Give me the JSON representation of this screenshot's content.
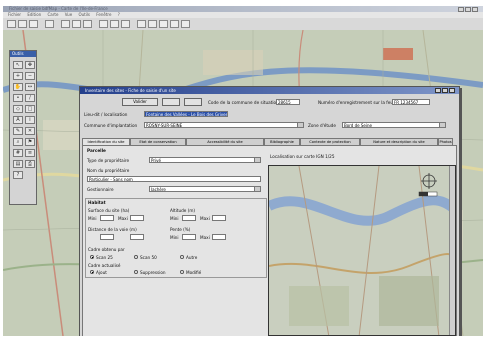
{
  "app": {
    "title": "Fichier de saisie bdfMap - Carte de l'Ile-de-France",
    "menu": [
      "Fichier",
      "Edition",
      "Carte",
      "Vue",
      "Outils",
      "Fenêtre",
      "?"
    ]
  },
  "palette": {
    "title": "Outils"
  },
  "dialog": {
    "title": "Inventaire des sites - Fiche de saisie d'un site",
    "save_label": "Valider",
    "collection_label": "Code de la commune de situation",
    "collection_value": "28615",
    "report_label": "Numéro d'enregistrement sur la feuille",
    "report_value": "FR 1234567",
    "locality_label": "Lieu-dit / localisation",
    "locality_value": "Fontaine des Vallées - Le Bois des Grives",
    "commune_label": "Commune d'implantation",
    "commune_value": "ROSNY-SUR-SEINE",
    "zone_label": "Zone d'étude",
    "zone_value": "Bord de Seine"
  },
  "tabs": [
    "Identification du site",
    "Etat de conservation",
    "Accessibilité du site",
    "Bibliographie",
    "Contexte de protection",
    "Nature et description du site",
    "Photos"
  ],
  "form": {
    "section_title": "Parcelle",
    "type_label": "Type de propriétaire",
    "type_value": "Privé",
    "owner_label": "Nom du propriétaire",
    "owner_value": "Particulier - Sans nom",
    "usage_label": "Gestionnaire",
    "usage_value": "Jachère",
    "habitat_title": "Habitat",
    "surface_label": "Surface du site (ha)",
    "min_label": "Mini",
    "max_label": "Maxi",
    "altitude_label": "Altitude (m)",
    "distance_label": "Distance de la voie (m)",
    "slope_label": "Pente (%)",
    "radio_group1_label": "Cadre obtenu par",
    "radio_group1_options": [
      "Scan 25",
      "Scan 50",
      "Autre"
    ],
    "radio_group2_label": "Cadre actualisé",
    "radio_group2_options": [
      "Ajout",
      "Suppression",
      "Modifié"
    ]
  },
  "inset": {
    "title": "Localisation sur carte IGN 1/25"
  },
  "colors": {
    "title_bar": "#243f8c",
    "selection": "#2b50a8",
    "map_bg": "#c7cfbd"
  }
}
